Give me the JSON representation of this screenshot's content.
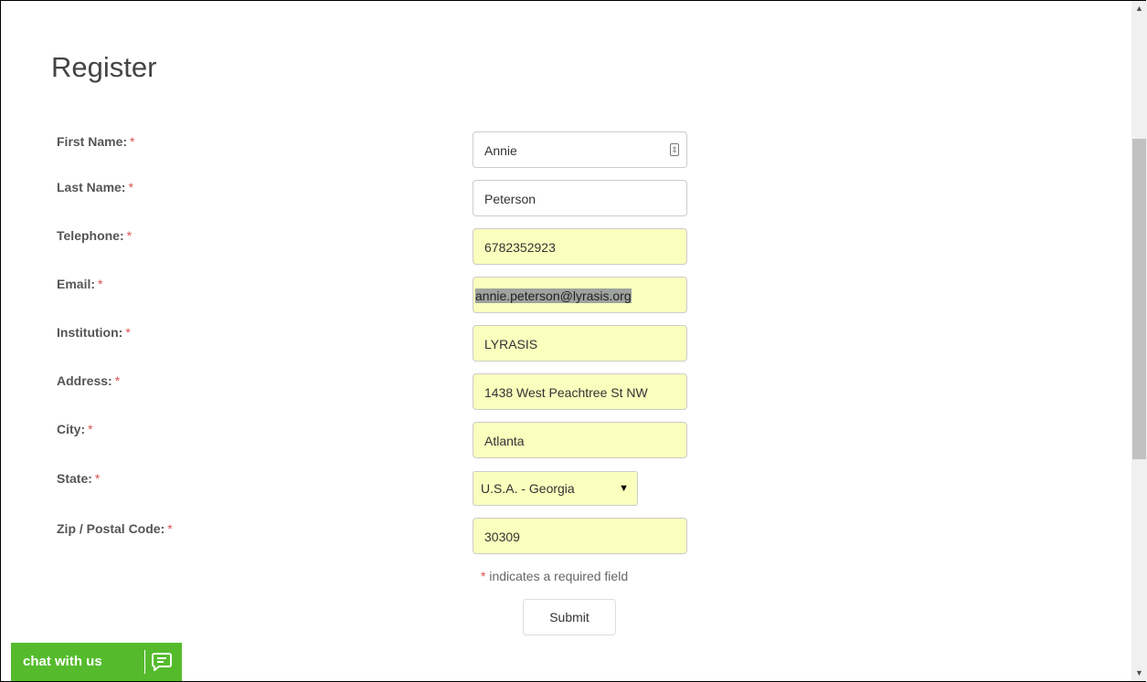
{
  "page": {
    "title": "Register"
  },
  "form": {
    "fields": [
      {
        "label": "First Name:",
        "required": "*",
        "value": "Annie"
      },
      {
        "label": "Last Name:",
        "required": "*",
        "value": "Peterson"
      },
      {
        "label": "Telephone:",
        "required": "*",
        "value": "6782352923"
      },
      {
        "label": "Email:",
        "required": "*",
        "value": "annie.peterson@lyrasis.org"
      },
      {
        "label": "Institution:",
        "required": "*",
        "value": "LYRASIS"
      },
      {
        "label": "Address:",
        "required": "*",
        "value": "1438 West Peachtree St NW"
      },
      {
        "label": "City:",
        "required": "*",
        "value": "Atlanta"
      },
      {
        "label": "State:",
        "required": "*",
        "value": "U.S.A. - Georgia",
        "arrow": "▼"
      },
      {
        "label": "Zip / Postal Code:",
        "required": "*",
        "value": "30309"
      }
    ],
    "required_note_star": "*",
    "required_note": " indicates a required field",
    "submit_label": "Submit"
  },
  "chat": {
    "label": "chat with us",
    "icon": "chat-bubble-icon"
  },
  "colors": {
    "autofill": "#faffbd",
    "chat": "#55bb2d",
    "required": "#d9534f"
  }
}
